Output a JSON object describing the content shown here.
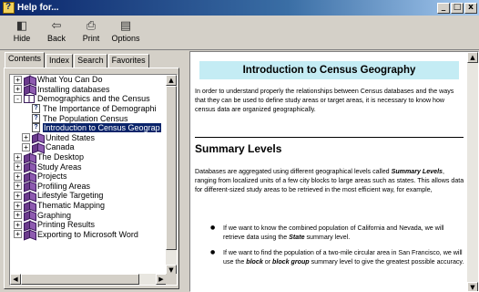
{
  "window": {
    "title": "Help for...",
    "minimize": "_",
    "maximize": "□",
    "close": "x"
  },
  "toolbar": {
    "buttons": [
      {
        "label": "Hide",
        "icon": "hide-icon",
        "glyph": "◧"
      },
      {
        "label": "Back",
        "icon": "back-arrow-icon",
        "glyph": "⇦"
      },
      {
        "label": "Print",
        "icon": "printer-icon",
        "glyph": "⎙"
      },
      {
        "label": "Options",
        "icon": "options-icon",
        "glyph": "▤"
      }
    ]
  },
  "tabs": [
    {
      "label": "Contents",
      "active": true
    },
    {
      "label": "Index",
      "active": false
    },
    {
      "label": "Search",
      "active": false
    },
    {
      "label": "Favorites",
      "active": false
    }
  ],
  "tree": [
    {
      "level": 0,
      "type": "book",
      "expander": "+",
      "label": "What You Can Do"
    },
    {
      "level": 0,
      "type": "book",
      "expander": "+",
      "label": "Installing databases"
    },
    {
      "level": 0,
      "type": "openbook",
      "expander": "-",
      "label": "Demographics and the Census"
    },
    {
      "level": 1,
      "type": "page",
      "label": "The Importance of Demographi"
    },
    {
      "level": 1,
      "type": "page",
      "label": "The Population Census"
    },
    {
      "level": 1,
      "type": "page",
      "label": "Introduction to Census Geograp",
      "selected": true
    },
    {
      "level": 1,
      "type": "book",
      "expander": "+",
      "label": "United States"
    },
    {
      "level": 1,
      "type": "book",
      "expander": "+",
      "label": "Canada"
    },
    {
      "level": 0,
      "type": "book",
      "expander": "+",
      "label": "The Desktop"
    },
    {
      "level": 0,
      "type": "book",
      "expander": "+",
      "label": "Study Areas"
    },
    {
      "level": 0,
      "type": "book",
      "expander": "+",
      "label": "Projects"
    },
    {
      "level": 0,
      "type": "book",
      "expander": "+",
      "label": "Profiling Areas"
    },
    {
      "level": 0,
      "type": "book",
      "expander": "+",
      "label": "Lifestyle Targeting"
    },
    {
      "level": 0,
      "type": "book",
      "expander": "+",
      "label": "Thematic Mapping"
    },
    {
      "level": 0,
      "type": "book",
      "expander": "+",
      "label": "Graphing"
    },
    {
      "level": 0,
      "type": "book",
      "expander": "+",
      "label": "Printing Results"
    },
    {
      "level": 0,
      "type": "book",
      "expander": "+",
      "label": "Exporting to Microsoft Word"
    }
  ],
  "content": {
    "title": "Introduction to Census Geography",
    "intro": "In order to understand properly the relationships between Census databases and the ways that they can be used to define study areas or target areas, it is necessary to know how census data are organized geographically.",
    "section_title": "Summary Levels",
    "p2_before": "Databases are aggregated using different geographical levels called ",
    "p2_term": "Summary Levels",
    "p2_after": ", ranging from localized units of a few city blocks to large areas such as states. This allows data for different-sized study areas to be retrieved in the most efficient way, for example,",
    "bullet1_before": "If we want to know the combined population of California and Nevada, we will retrieve data using the ",
    "bullet1_term": "State",
    "bullet1_after": " summary level.",
    "bullet2_before": "If we want to find the population of a two-mile circular area in San Francisco, we will use the ",
    "bullet2_term1": "block",
    "bullet2_mid": " or ",
    "bullet2_term2": "block group",
    "bullet2_after": " summary level to give the greatest possible accuracy."
  },
  "colors": {
    "title_bg": "#c4ecf4",
    "selection": "#0a246a",
    "titlebar": "#0a246a"
  }
}
